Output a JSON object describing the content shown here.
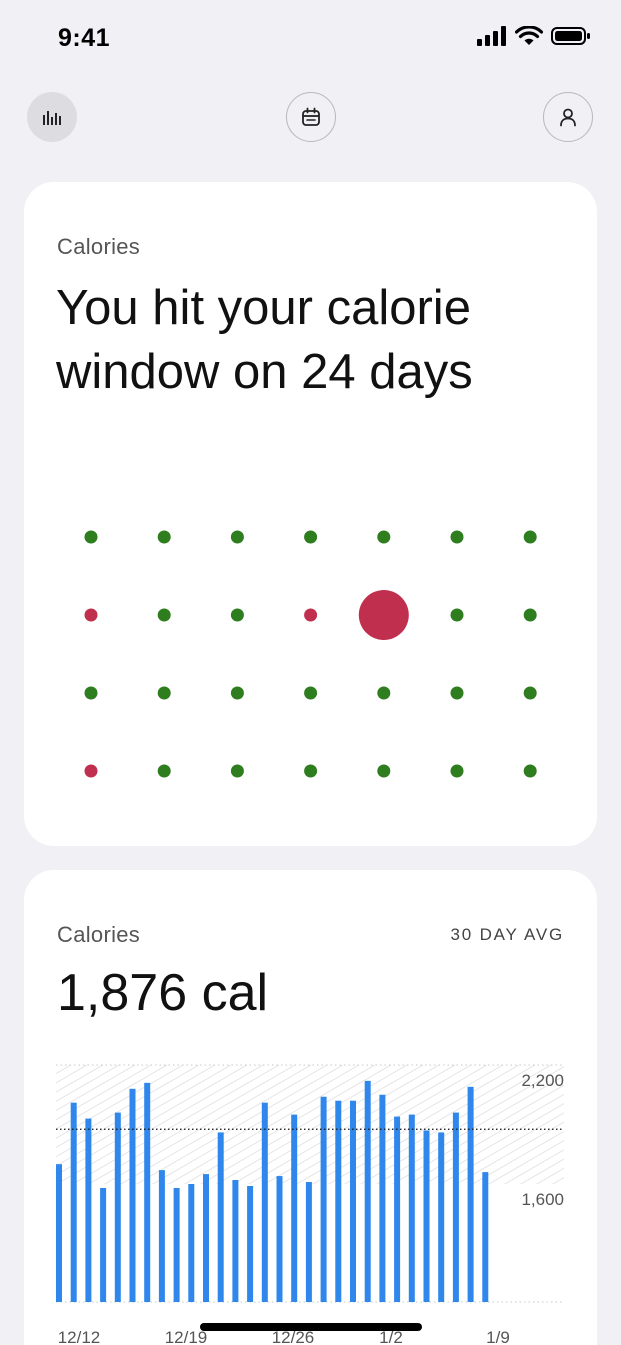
{
  "status_bar": {
    "time": "9:41"
  },
  "colors": {
    "hit": "#2e7d1e",
    "miss": "#c0304e",
    "bar": "#2f86eb",
    "background": "#f0f0f5"
  },
  "nav": {
    "left_icon": "bar-chart-icon",
    "center_icon": "calendar-icon",
    "right_icon": "person-icon"
  },
  "calorie_window_card": {
    "label": "Calories",
    "headline": "You hit your calorie window on 24 days",
    "days_hit": 24,
    "grid": {
      "rows": [
        [
          "hit",
          "hit",
          "hit",
          "hit",
          "hit",
          "hit",
          "hit"
        ],
        [
          "miss",
          "hit",
          "hit",
          "miss",
          "today",
          "hit",
          "hit"
        ],
        [
          "hit",
          "hit",
          "hit",
          "hit",
          "hit",
          "hit",
          "hit"
        ],
        [
          "miss",
          "hit",
          "hit",
          "hit",
          "hit",
          "hit",
          "hit"
        ]
      ]
    }
  },
  "calorie_avg_card": {
    "label": "Calories",
    "period": "30 DAY AVG",
    "value": "1,876 cal",
    "chart_data": {
      "type": "bar",
      "ylabel": "",
      "y_ticks": [
        "2,200",
        "1,600"
      ],
      "x_ticks": [
        "12/12",
        "12/19",
        "12/26",
        "1/2",
        "1/9"
      ],
      "target_band": [
        1600,
        2200
      ],
      "average_line": 1876,
      "values": [
        1700,
        2010,
        1930,
        1580,
        1960,
        2080,
        2110,
        1670,
        1580,
        1600,
        1650,
        1860,
        1620,
        1590,
        2010,
        1640,
        1950,
        1610,
        2040,
        2020,
        2020,
        2120,
        2050,
        1940,
        1950,
        1870,
        1860,
        1960,
        2090,
        1660
      ],
      "grid": false
    }
  }
}
